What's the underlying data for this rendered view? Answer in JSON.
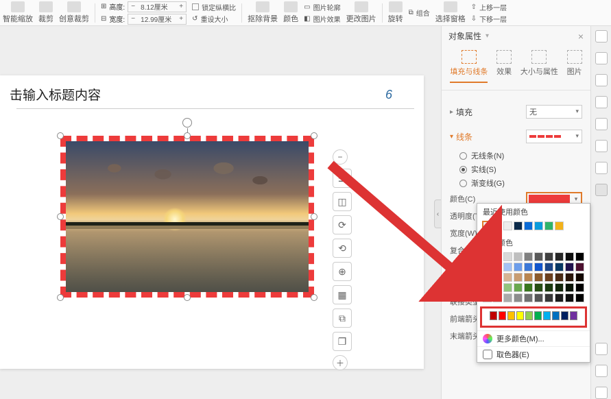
{
  "ribbon": {
    "smart_zoom": "智能缩放",
    "crop": "裁剪",
    "creative_crop": "创意裁剪",
    "height_label": "高度:",
    "height_value": "8.12厘米",
    "width_label": "宽度:",
    "width_value": "12.99厘米",
    "lock_ratio": "锁定纵横比",
    "reset_size": "重设大小",
    "remove_bg": "抠除背景",
    "color": "颜色",
    "pic_outline": "图片轮廓",
    "pic_effect": "图片效果",
    "change_pic": "更改图片",
    "rotate": "旋转",
    "group": "组合",
    "select_pane": "选择窗格",
    "up_layer": "上移一层",
    "down_layer": "下移一层"
  },
  "panel": {
    "title": "对象属性",
    "tabs": {
      "fill_line": "填充与线条",
      "effect": "效果",
      "size_props": "大小与属性",
      "image": "图片"
    },
    "fill_section": "填充",
    "fill_value": "无",
    "line_section": "线条",
    "radio_none": "无线条(N)",
    "radio_solid": "实线(S)",
    "radio_gradient": "渐变线(G)",
    "color_label": "颜色(C)",
    "opacity_label": "透明度(T)",
    "width_label": "宽度(W)",
    "compound_label": "复合类型(C)",
    "dash_label": "短划线类型",
    "cap_label": "端点类型",
    "join_label": "联接类型(J)",
    "arrow_front_label": "前端箭头(F)",
    "arrow_end_label": "末端箭头(N)"
  },
  "color_pop": {
    "recent": "最近使用颜色",
    "recent_colors": [
      "#ededed",
      "#ededed",
      "#ededed",
      "#0b2a4a",
      "#0b6bd6",
      "#0a9bdc",
      "#2fb36a",
      "#f3b21a"
    ],
    "theme": "主题颜色",
    "theme_rows": [
      [
        "#ffffff",
        "#f2f2f2",
        "#d9d9d9",
        "#bfbfbf",
        "#808080",
        "#595959",
        "#3f3f3f",
        "#262626",
        "#0d0d0d",
        "#000000"
      ],
      [
        "#e9f1fb",
        "#cfe2f3",
        "#a4c2f4",
        "#6d9eeb",
        "#3c78d8",
        "#1155cc",
        "#1c4587",
        "#073763",
        "#20124d",
        "#4c1130"
      ],
      [
        "#f4e3d7",
        "#e6cbb5",
        "#d7b493",
        "#c99d72",
        "#ba8650",
        "#8b5a2b",
        "#6b3f1d",
        "#4a2a13",
        "#2a1509",
        "#120700"
      ],
      [
        "#dce9d5",
        "#b6d7a8",
        "#93c47d",
        "#6aa84f",
        "#38761d",
        "#274e13",
        "#1b3a0e",
        "#12260a",
        "#091305",
        "#000000"
      ],
      [
        "#e2e2e2",
        "#c6c6c6",
        "#aaaaaa",
        "#8d8d8d",
        "#717171",
        "#555555",
        "#383838",
        "#1c1c1c",
        "#0e0e0e",
        "#000000"
      ]
    ],
    "standard_label": "标准颜色",
    "standard": [
      "#c00000",
      "#ff0000",
      "#ffc000",
      "#ffff00",
      "#92d050",
      "#00b050",
      "#00b0f0",
      "#0070c0",
      "#002060",
      "#7030a0"
    ],
    "more": "更多颜色(M)...",
    "picker": "取色器(E)"
  },
  "slide": {
    "title_placeholder": "击输入标题内容",
    "page_number": "6"
  },
  "float_tools": {
    "minus": "−",
    "layers": "layers-icon",
    "crop": "crop-icon",
    "rotate": "rotate-icon",
    "replace": "replace-icon",
    "zoom": "zoom-icon",
    "select": "select-icon",
    "copy": "copy-icon",
    "copy2": "copy-icon-2",
    "plus": "＋"
  }
}
